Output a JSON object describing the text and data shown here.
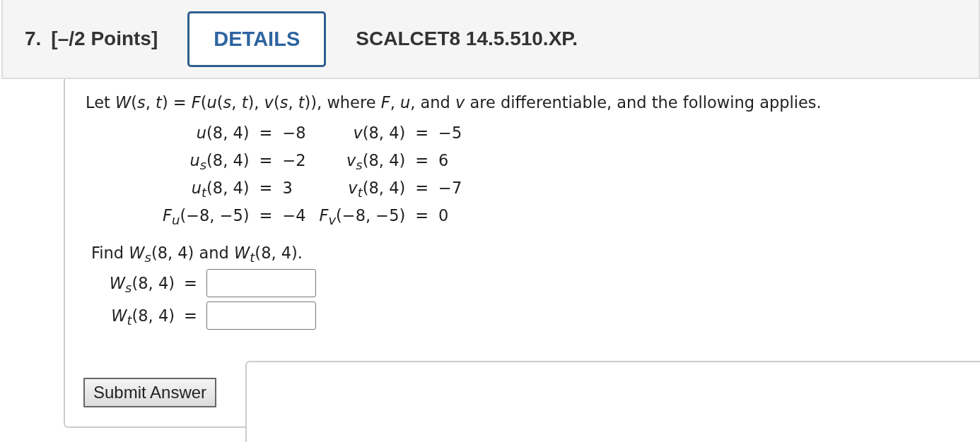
{
  "header": {
    "number": "7.",
    "points": "[–/2 Points]",
    "details_button": "DETAILS",
    "problem_id": "SCALCET8 14.5.510.XP."
  },
  "problem": {
    "intro": "Let *W*(*s*, *t*) = *F*(*u*(*s*, *t*), *v*(*s*, *t*)), where *F*, *u*, and *v* are differentiable, and the following applies.",
    "equations": [
      {
        "left": {
          "lhs": "*u*(8, 4)",
          "eq": "=",
          "rhs": "−8"
        },
        "right": {
          "lhs": "*v*(8, 4)",
          "eq": "=",
          "rhs": "−5"
        }
      },
      {
        "left": {
          "lhs": "*u*$_{s}$(8, 4)",
          "eq": "=",
          "rhs": "−2"
        },
        "right": {
          "lhs": "*v*$_{s}$(8, 4)",
          "eq": "=",
          "rhs": "6"
        }
      },
      {
        "left": {
          "lhs": "*u*$_{t}$(8, 4)",
          "eq": "=",
          "rhs": "3"
        },
        "right": {
          "lhs": "*v*$_{t}$(8, 4)",
          "eq": "=",
          "rhs": "−7"
        }
      },
      {
        "left": {
          "lhs": "*F*$_{u}$(−8, −5)",
          "eq": "=",
          "rhs": "−4"
        },
        "right": {
          "lhs": "*F*$_{v}$(−8, −5)",
          "eq": "=",
          "rhs": "0"
        }
      }
    ],
    "question": "Find *W*$_{s}$(8, 4) and *W*$_{t}$(8, 4).",
    "answers": [
      {
        "label": "*W*$_{s}$(8, 4)",
        "eq": "="
      },
      {
        "label": "*W*$_{t}$(8, 4)",
        "eq": "="
      }
    ],
    "submit_button": "Submit Answer"
  }
}
